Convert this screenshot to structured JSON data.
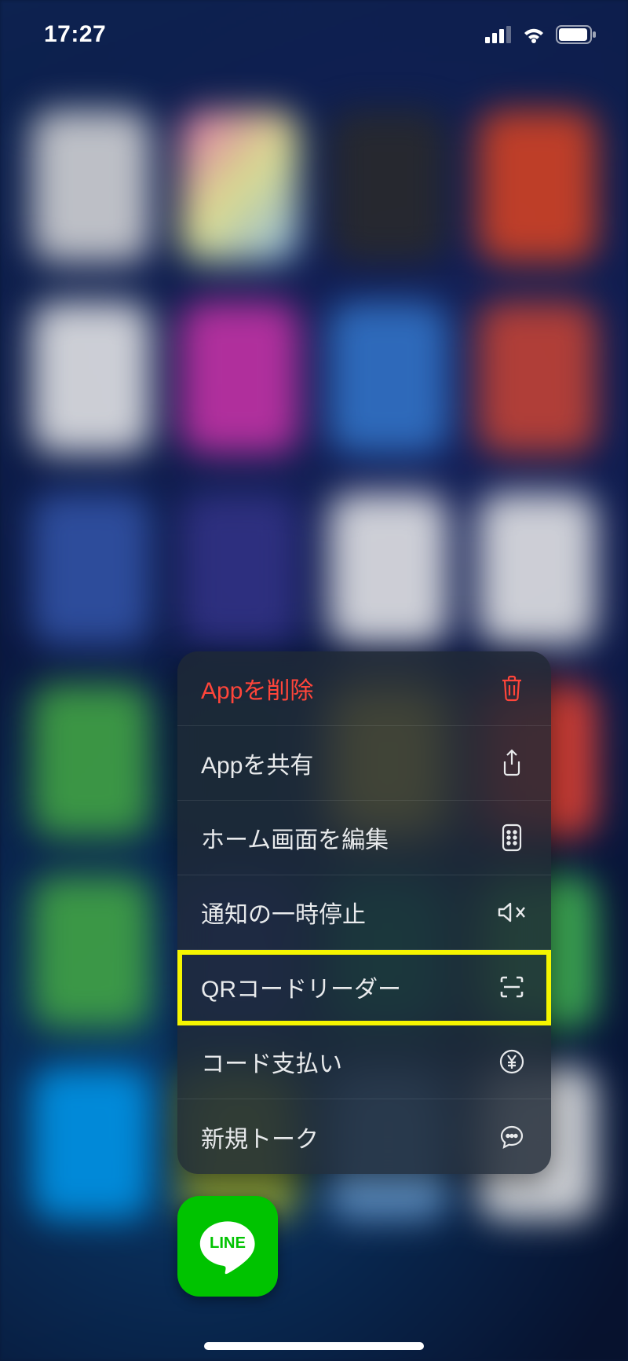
{
  "status": {
    "time": "17:27"
  },
  "menu": {
    "items": [
      {
        "label": "Appを削除",
        "icon": "trash-icon",
        "destructive": true
      },
      {
        "label": "Appを共有",
        "icon": "share-icon",
        "destructive": false
      },
      {
        "label": "ホーム画面を編集",
        "icon": "apps-icon",
        "destructive": false
      },
      {
        "label": "通知の一時停止",
        "icon": "mute-icon",
        "destructive": false
      },
      {
        "label": "QRコードリーダー",
        "icon": "scan-icon",
        "destructive": false
      },
      {
        "label": "コード支払い",
        "icon": "yen-icon",
        "destructive": false
      },
      {
        "label": "新規トーク",
        "icon": "chat-icon",
        "destructive": false
      }
    ],
    "highlight_index": 4
  },
  "app": {
    "name": "LINE"
  }
}
